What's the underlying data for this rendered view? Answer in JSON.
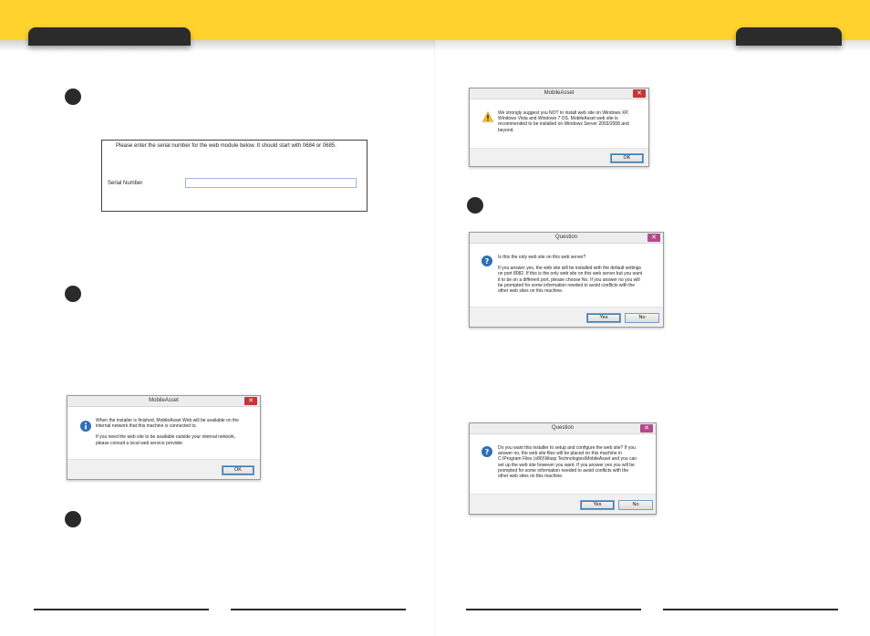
{
  "serial_panel": {
    "message": "Please enter the serial number for the web module below. It should start with 0684 or 0685.",
    "label": "Serial Number",
    "value": ""
  },
  "dialog_info": {
    "title": "MobileAsset",
    "lines": [
      "When the installer is finished, MobileAsset Web will be available on the",
      "internal network that this machine is connected to.",
      "",
      "If you need the web site to be available outside your internal network,",
      "please consult a local web service provider."
    ],
    "ok_label": "OK"
  },
  "dialog_warning": {
    "title": "MobileAsset",
    "lines": [
      "We strongly suggest you NOT to install web site on Windows XP,",
      "Windows Vista and Windows 7 OS. MobileAsset web site is",
      "recommended to be installed on Windows Server 2003/2008 and",
      "beyond."
    ],
    "ok_label": "OK"
  },
  "dialog_question_1": {
    "title": "Question",
    "lines": [
      "Is this the only web site on this web server?",
      "",
      "If you answer yes, the web site will be installed with the default settings",
      "on port 8082. If this is the only web site on this web server but you want",
      "it to be on a different port, please choose No. If you answer no you will",
      "be prompted for some information needed to avoid conflicts with the",
      "other web sites on this machine."
    ],
    "yes_label": "Yes",
    "no_label": "No"
  },
  "dialog_question_2": {
    "title": "Question",
    "lines": [
      "Do you want this installer to setup and configure the web site? If you",
      "answer no, the web site files will be placed on this machine in",
      "C:\\Program Files (x86)\\Wasp Technologies\\MobileAsset and you can",
      "set up the web site however you want. If you answer yes you will be",
      "prompted for some information needed to avoid conflicts with the",
      "other web sites on this machine."
    ],
    "yes_label": "Yes",
    "no_label": "No"
  },
  "icons": {
    "close": "close-icon",
    "info": "info-icon",
    "warning": "warning-icon",
    "question": "question-icon"
  },
  "colors": {
    "header_yellow": "#ffd22e",
    "tab_dark": "#2b2b2b",
    "close_red": "#c9333b",
    "question_blue": "#2f6fb3"
  }
}
